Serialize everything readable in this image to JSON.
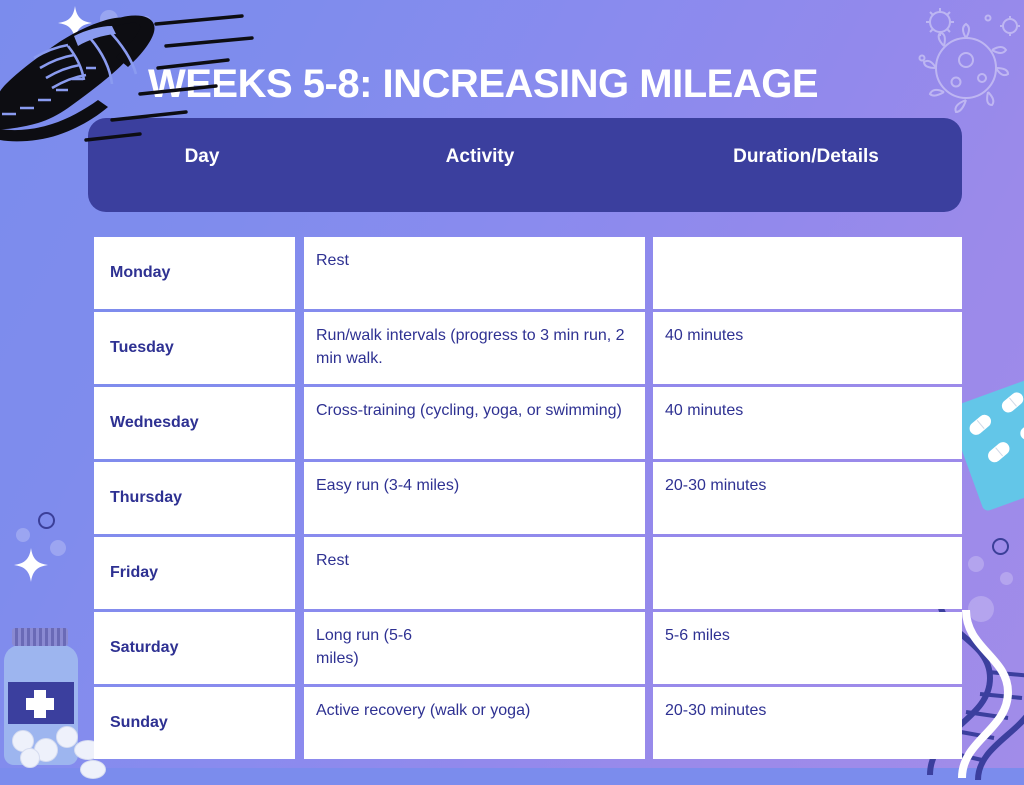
{
  "title": "WEEKS 5-8: INCREASING MILEAGE",
  "colors": {
    "header_bar": "#3b3f9e",
    "text_navy": "#2e3192",
    "cell_background": "#ffffff",
    "background_start": "#7b8ced",
    "background_end": "#a18ce9",
    "title_text": "#ffffff"
  },
  "table": {
    "headers": {
      "day": "Day",
      "activity": "Activity",
      "duration": "Duration/Details"
    },
    "rows": [
      {
        "day": "Monday",
        "activity": "Rest",
        "duration": ""
      },
      {
        "day": "Tuesday",
        "activity": "Run/walk intervals (progress to 3 min run, 2 min walk.",
        "duration": "40 minutes"
      },
      {
        "day": "Wednesday",
        "activity": "Cross-training (cycling, yoga, or swimming)",
        "duration": "40 minutes"
      },
      {
        "day": "Thursday",
        "activity": "Easy run (3-4 miles)",
        "duration": "20-30 minutes"
      },
      {
        "day": "Friday",
        "activity": "Rest",
        "duration": ""
      },
      {
        "day": "Saturday",
        "activity": "Long run (5-6\nmiles)",
        "duration": "5-6 miles"
      },
      {
        "day": "Sunday",
        "activity": "Active recovery (walk or yoga)",
        "duration": "20-30 minutes"
      }
    ]
  },
  "decorations": {
    "shoe": "running-shoe-illustration",
    "pill_bottle": "pill-bottle-illustration",
    "blister_pack": "blister-pack-illustration",
    "dna": "dna-helix-illustration",
    "virus": "virus-outline-pattern",
    "sparkles": "sparkle-star-decoration"
  }
}
